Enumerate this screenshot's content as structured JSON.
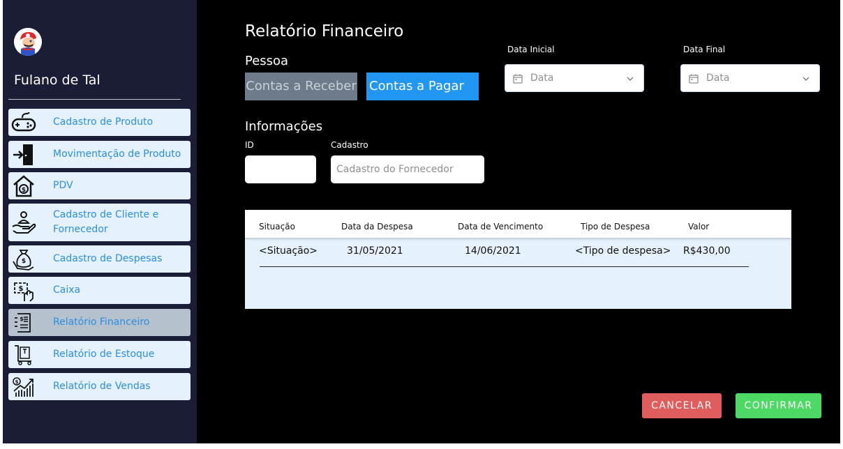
{
  "user": {
    "name": "Fulano de Tal"
  },
  "sidebar": {
    "items": [
      {
        "label": "Cadastro de Produto",
        "icon": "gamepad-icon"
      },
      {
        "label": "Movimentação de Produto",
        "icon": "door-enter-icon"
      },
      {
        "label": "PDV",
        "icon": "house-dollar-icon"
      },
      {
        "label": "Cadastro de Cliente e Fornecedor",
        "icon": "hand-person-icon"
      },
      {
        "label": "Cadastro de Despesas",
        "icon": "money-bag-hand-icon"
      },
      {
        "label": "Caixa",
        "icon": "cash-hand-icon"
      },
      {
        "label": "Relatório Financeiro",
        "icon": "financial-report-icon",
        "active": true
      },
      {
        "label": "Relatório de Estoque",
        "icon": "stock-cart-icon"
      },
      {
        "label": "Relatório de Vendas",
        "icon": "sales-chart-icon"
      }
    ]
  },
  "main": {
    "title": "Relatório Financeiro",
    "pessoa_label": "Pessoa",
    "btn_receber": "Contas a Receber",
    "btn_pagar": "Contas a Pagar",
    "data_inicial_label": "Data Inicial",
    "data_final_label": "Data Final",
    "date_placeholder": "Data",
    "informacoes_label": "Informações",
    "id_label": "ID",
    "cadastro_label": "Cadastro",
    "cadastro_placeholder": "Cadastro do Fornecedor"
  },
  "table": {
    "headers": [
      "Situação",
      "Data da Despesa",
      "Data de Vencimento",
      "Tipo de Despesa",
      "Valor"
    ],
    "rows": [
      [
        "<Situação>",
        "31/05/2021",
        "14/06/2021",
        "<Tipo de despesa>",
        "R$430,00"
      ]
    ]
  },
  "actions": {
    "cancel": "CANCELAR",
    "confirm": "CONFIRMAR"
  },
  "colors": {
    "sidebar_bg": "#1b1c36",
    "menu_item_bg": "#e5f1fc",
    "menu_item_active_bg": "#b5c1cc",
    "menu_text": "#2a8fe0",
    "btn_receber_bg": "#6d7b8a",
    "btn_pagar_bg": "#2196f3",
    "cancel_bg": "#e05d5d",
    "confirm_bg": "#4cd964"
  }
}
